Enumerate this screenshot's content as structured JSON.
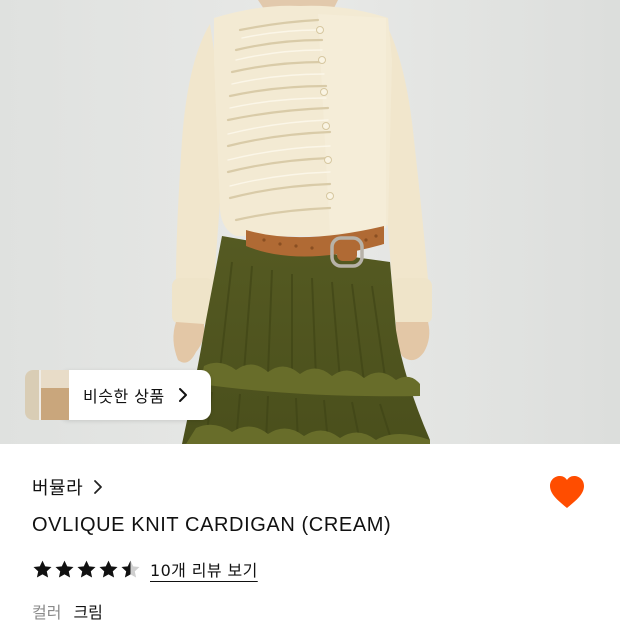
{
  "similar": {
    "label": "비슷한 상품"
  },
  "product": {
    "brand": "버뮬라",
    "title": "OVLIQUE KNIT CARDIGAN (CREAM)",
    "rating": 4.5,
    "review_link": "10개 리뷰 보기",
    "color_label": "컬러",
    "color_value": "크림"
  },
  "icons": {
    "similar_chevron": "chevron-right-icon",
    "brand_chevron": "chevron-right-icon",
    "wishlist": "heart-icon",
    "star": "star-icon"
  },
  "colors": {
    "accent": "#ff4d00",
    "background": "#ffffff",
    "text_primary": "#111111",
    "text_secondary": "#8a8a8a",
    "photo_bg": "#e4e6e5",
    "cardigan": "#f3ead3",
    "skirt": "#5a5a22",
    "belt": "#b06a34"
  }
}
